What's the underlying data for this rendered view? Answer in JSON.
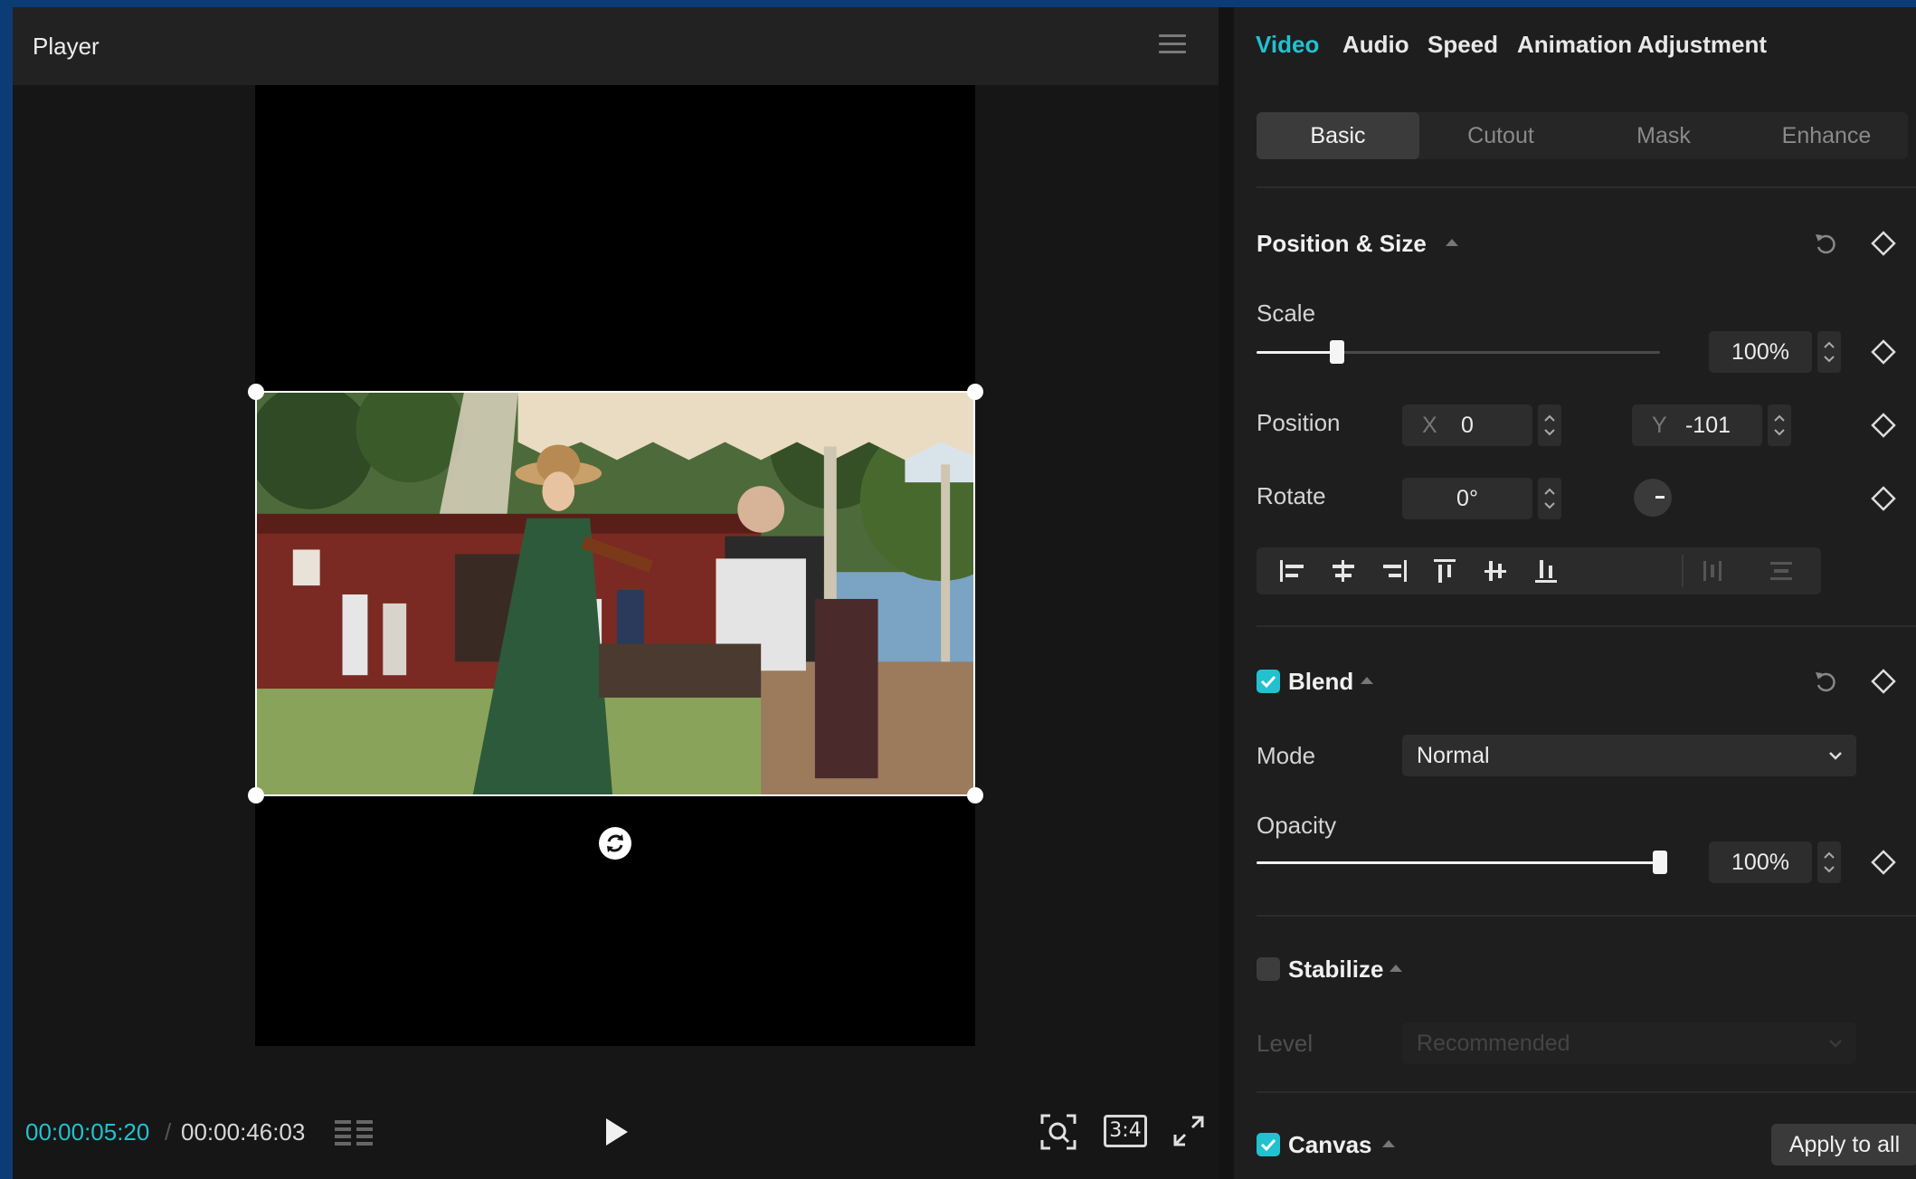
{
  "player": {
    "title": "Player",
    "time_current": "00:00:05:20",
    "time_separator": "/",
    "time_total": "00:00:46:03",
    "ratio_label": "3:4"
  },
  "tabs": [
    "Video",
    "Audio",
    "Speed",
    "Animation",
    "Adjustment"
  ],
  "active_tab": "Video",
  "subtabs": [
    "Basic",
    "Cutout",
    "Mask",
    "Enhance"
  ],
  "active_subtab": "Basic",
  "position_size": {
    "title": "Position & Size",
    "scale_label": "Scale",
    "scale_value": "100%",
    "scale_level": 0.2,
    "position_label": "Position",
    "x_prefix": "X",
    "x_value": "0",
    "y_prefix": "Y",
    "y_value": "-101",
    "rotate_label": "Rotate",
    "rotate_value": "0°"
  },
  "blend": {
    "title": "Blend",
    "enabled": true,
    "mode_label": "Mode",
    "mode_value": "Normal",
    "opacity_label": "Opacity",
    "opacity_value": "100%",
    "opacity_level": 1.0
  },
  "stabilize": {
    "title": "Stabilize",
    "enabled": false,
    "level_label": "Level",
    "level_value": "Recommended"
  },
  "canvas": {
    "title": "Canvas",
    "enabled": true,
    "apply_label": "Apply to all"
  },
  "colors": {
    "accent": "#22c1d0",
    "panel_bg": "#1e1e1e",
    "player_bg": "#161616"
  }
}
